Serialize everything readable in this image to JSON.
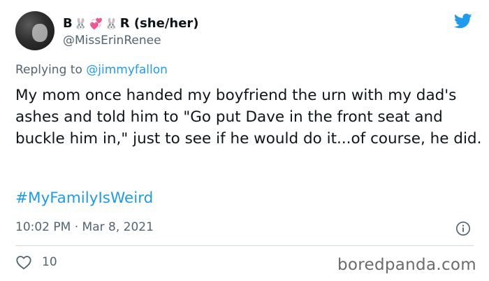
{
  "author": {
    "name_start": "B",
    "emoji_1": "🐰",
    "emoji_2": "💞",
    "emoji_3": "🐰",
    "name_end": "R (she/her)",
    "handle": "@MissErinRenee"
  },
  "reply": {
    "prefix": "Replying to",
    "mention": "@jimmyfallon"
  },
  "tweet": {
    "text": "My mom once handed my boyfriend the urn with my dad's ashes and told him to \"Go put Dave in the front seat and buckle him in,\" just to see if he would do it...of course, he did.",
    "hashtag": "#MyFamilyIsWeird",
    "timestamp": "10:02 PM · Mar 8, 2021"
  },
  "stats": {
    "likes": "10"
  },
  "watermark": "boredpanda.com",
  "colors": {
    "accent": "#1d9bf0",
    "muted": "#536471",
    "text": "#0f1419"
  },
  "icons": {
    "brand": "twitter-bird-icon",
    "info": "info-icon",
    "like": "heart-icon"
  }
}
